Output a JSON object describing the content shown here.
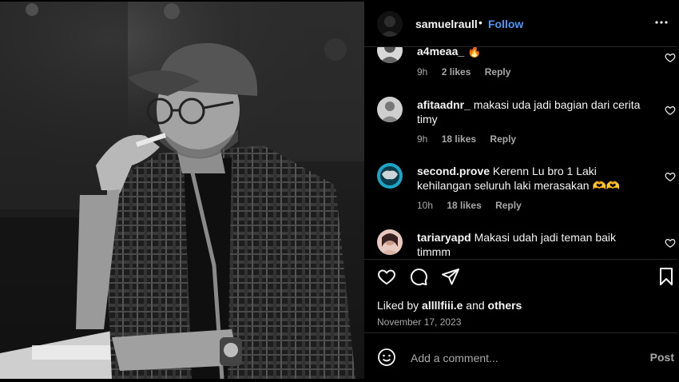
{
  "header": {
    "username": "samuelraull",
    "separator": "•",
    "follow_label": "Follow"
  },
  "comments": [
    {
      "username": "a4meaa_",
      "text": "🔥",
      "time": "9h",
      "likes": "2 likes",
      "reply": "Reply"
    },
    {
      "username": "afitaadnr_",
      "text": "makasi uda jadi bagian dari cerita timy",
      "time": "9h",
      "likes": "18 likes",
      "reply": "Reply"
    },
    {
      "username": "second.prove",
      "text": "Kerenn Lu bro 1 Laki kehilangan seluruh laki merasakan 🫶🫶",
      "time": "10h",
      "likes": "18 likes",
      "reply": "Reply"
    },
    {
      "username": "tariaryapd",
      "text": "Makasi udah jadi teman baik timmm",
      "time": "",
      "likes": "",
      "reply": ""
    }
  ],
  "actions": {
    "liked_prefix": "Liked by",
    "liked_user": "allllfiii.e",
    "liked_and": "and",
    "liked_others": "others",
    "date": "November 17, 2023"
  },
  "composer": {
    "placeholder": "Add a comment...",
    "post_label": "Post"
  },
  "colors": {
    "link": "#4a98f7",
    "muted": "#a8a8a8",
    "divider": "#262626"
  },
  "icons": [
    "more-icon",
    "heart-icon",
    "comment-icon",
    "share-icon",
    "bookmark-icon",
    "emoji-icon"
  ]
}
